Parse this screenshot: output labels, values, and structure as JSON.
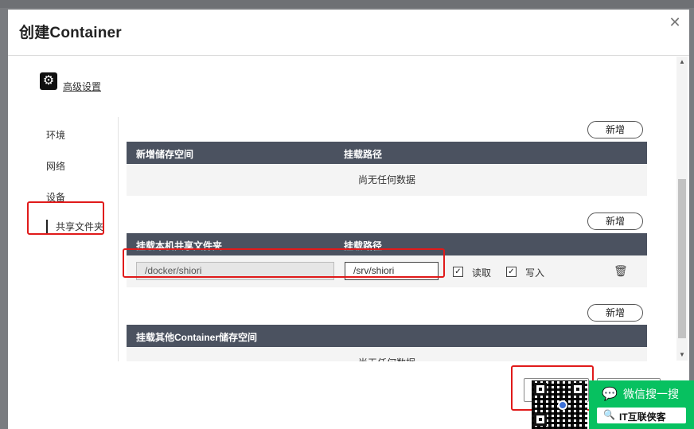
{
  "dialog": {
    "title": "创建Container",
    "close_icon": "close-icon"
  },
  "advanced": {
    "icon": "gear-icon",
    "label": "高级设置"
  },
  "nav": {
    "items": [
      {
        "label": "环境"
      },
      {
        "label": "网络"
      },
      {
        "label": "设备"
      },
      {
        "label": "共享文件夹"
      }
    ],
    "active_index": 3
  },
  "sections": {
    "storage": {
      "add_label": "新增",
      "col1": "新增储存空间",
      "col2": "挂载路径",
      "empty": "尚无任何数据"
    },
    "shared": {
      "add_label": "新增",
      "col1": "挂载本机共享文件夹",
      "col2": "挂载路径",
      "row": {
        "host_path": "/docker/shiori",
        "mount_path": "/srv/shiori",
        "read_label": "读取",
        "read_checked": true,
        "write_label": "写入",
        "write_checked": true,
        "delete_icon": "trash-icon"
      }
    },
    "container_storage": {
      "add_label": "新增",
      "col1": "挂载其他Container储存空间",
      "empty": "尚无任何数据"
    }
  },
  "watermark": {
    "wechat_label": "微信搜一搜",
    "account": "IT互联侠客"
  },
  "colors": {
    "table_header": "#4b5260",
    "highlight": "#e01a1a",
    "wechat_green": "#07c160"
  }
}
